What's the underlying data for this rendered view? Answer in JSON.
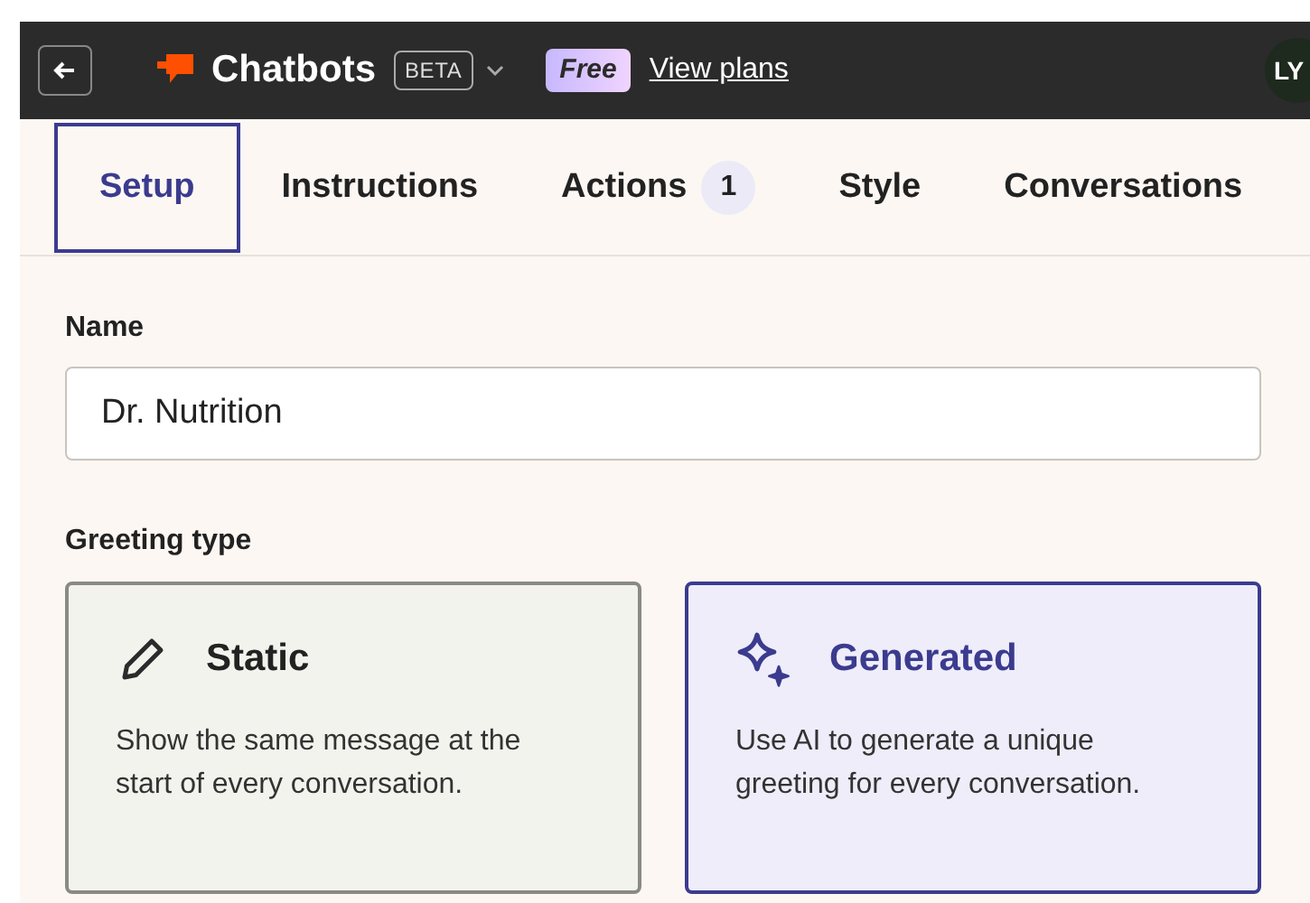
{
  "header": {
    "title": "Chatbots",
    "badge": "BETA",
    "plan": "Free",
    "plans_link": "View plans",
    "avatar": "LY"
  },
  "tabs": [
    {
      "label": "Setup",
      "selected": true
    },
    {
      "label": "Instructions",
      "selected": false
    },
    {
      "label": "Actions",
      "selected": false,
      "count": "1"
    },
    {
      "label": "Style",
      "selected": false
    },
    {
      "label": "Conversations",
      "selected": false
    }
  ],
  "name_field": {
    "label": "Name",
    "value": "Dr. Nutrition"
  },
  "greeting": {
    "label": "Greeting type",
    "options": [
      {
        "kind": "static",
        "title": "Static",
        "description": "Show the same message at the start of every conversation.",
        "selected": false
      },
      {
        "kind": "generated",
        "title": "Generated",
        "description": "Use AI to generate a unique greeting for every conversation.",
        "selected": true
      }
    ]
  }
}
